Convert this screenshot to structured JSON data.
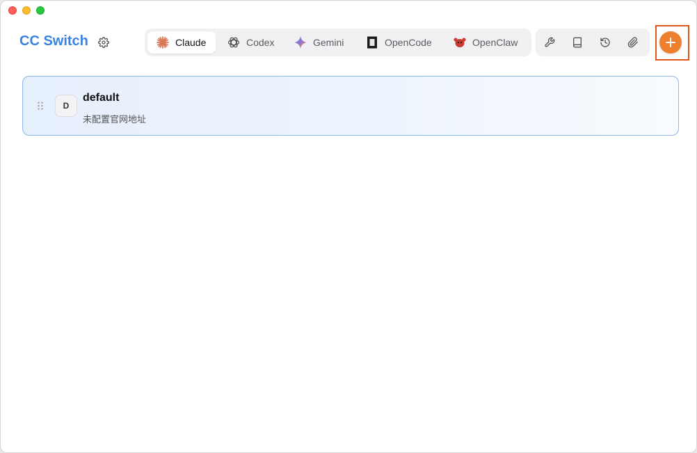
{
  "app": {
    "title": "CC Switch"
  },
  "tabs": [
    {
      "label": "Claude",
      "icon": "claude-icon",
      "active": true
    },
    {
      "label": "Codex",
      "icon": "codex-icon",
      "active": false
    },
    {
      "label": "Gemini",
      "icon": "gemini-icon",
      "active": false
    },
    {
      "label": "OpenCode",
      "icon": "opencode-icon",
      "active": false
    },
    {
      "label": "OpenClaw",
      "icon": "openclaw-icon",
      "active": false
    }
  ],
  "toolbar": {
    "icons": [
      "wrench-icon",
      "book-icon",
      "history-icon",
      "paperclip-icon"
    ],
    "add_icon": "plus-icon"
  },
  "providers": [
    {
      "avatar": "D",
      "name": "default",
      "subtitle": "未配置官网地址",
      "selected": true
    }
  ],
  "colors": {
    "brand": "#3a82e0",
    "accent": "#ee7f2e",
    "highlight_border": "#e0561c",
    "selected_border": "#8bb6ee"
  }
}
